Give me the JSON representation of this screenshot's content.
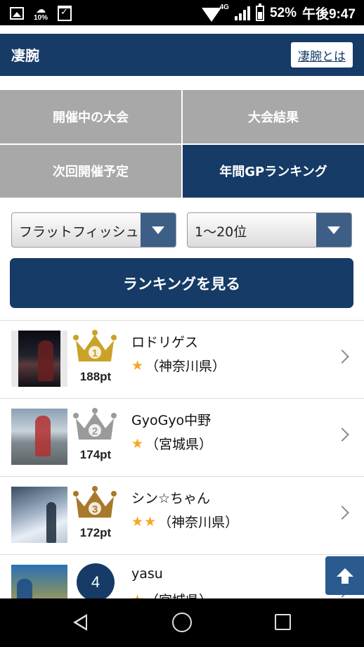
{
  "status_bar": {
    "weather_pct": "10%",
    "network": "4G",
    "battery": "52%",
    "time": "午後9:47"
  },
  "header": {
    "title": "凄腕",
    "about_link": "凄腕とは"
  },
  "tabs": [
    {
      "label": "開催中の大会",
      "active": false
    },
    {
      "label": "大会結果",
      "active": false
    },
    {
      "label": "次回開催予定",
      "active": false
    },
    {
      "label": "年間GPランキング",
      "active": true
    }
  ],
  "filters": {
    "category": "フラットフィッシュ",
    "rank_range": "1〜20位"
  },
  "view_button": "ランキングを見る",
  "ranking": [
    {
      "rank": 1,
      "crown": "gold",
      "points": "188pt",
      "name": "ロドリゲス",
      "stars": "★",
      "prefecture": "（神奈川県）"
    },
    {
      "rank": 2,
      "crown": "silver",
      "points": "174pt",
      "name": "GyoGyo中野",
      "stars": "★",
      "prefecture": "（宮城県）"
    },
    {
      "rank": 3,
      "crown": "bronze",
      "points": "172pt",
      "name": "シン☆ちゃん",
      "stars": "★★",
      "prefecture": "（神奈川県）"
    },
    {
      "rank": "4",
      "crown": null,
      "points": "",
      "name": "yasu",
      "stars": "★",
      "prefecture": "（宮城県）"
    }
  ],
  "colors": {
    "brand_navy": "#153b66",
    "tab_gray": "#a8a8a8",
    "star": "#f5a623",
    "gold": "#c9a227",
    "silver": "#9a9a9a",
    "bronze": "#a8792a"
  }
}
